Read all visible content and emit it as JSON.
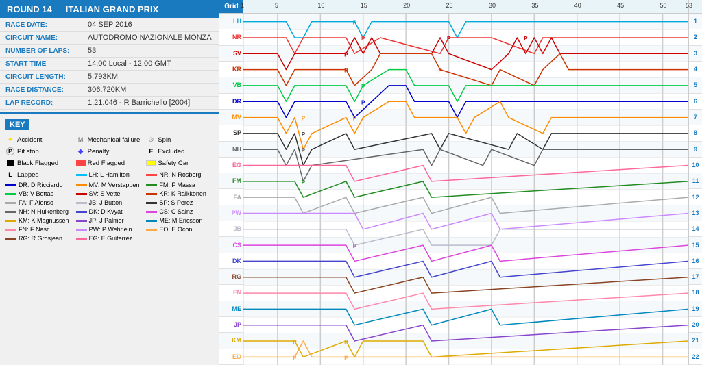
{
  "header": {
    "round": "ROUND 14",
    "race_name": "ITALIAN GRAND PRIX"
  },
  "race_info": [
    {
      "label": "RACE DATE:",
      "value": "04 SEP 2016"
    },
    {
      "label": "CIRCUIT NAME:",
      "value": "AUTODROMO NAZIONALE MONZA"
    },
    {
      "label": "NUMBER OF LAPS:",
      "value": "53"
    },
    {
      "label": "START TIME",
      "value": "14:00 Local - 12:00 GMT"
    },
    {
      "label": "CIRCUIT LENGTH:",
      "value": "5.793KM"
    },
    {
      "label": "RACE DISTANCE:",
      "value": "306.720KM"
    },
    {
      "label": "LAP RECORD:",
      "value": "1:21.046 - R Barrichello [2004]"
    }
  ],
  "key_title": "KEY",
  "key_legend": [
    {
      "icon": "star",
      "label": "Accident"
    },
    {
      "icon": "M",
      "label": "Mechanical failure"
    },
    {
      "icon": "circle-s",
      "label": "Spin"
    },
    {
      "icon": "P-circle",
      "label": "Pit stop"
    },
    {
      "icon": "diamond",
      "label": "Penalty"
    },
    {
      "icon": "E",
      "label": "Excluded"
    },
    {
      "icon": "black-square",
      "label": "Black Flagged"
    },
    {
      "icon": "red-rect",
      "label": "Red Flagged"
    },
    {
      "icon": "yellow-rect",
      "label": "Safety Car"
    },
    {
      "icon": "L",
      "label": "Lapped"
    },
    {
      "icon": "line-lh",
      "label": "LH: L Hamilton",
      "color": "#00bfff"
    },
    {
      "icon": "line-nr",
      "label": "NR: N Rosberg",
      "color": "#ff4444"
    },
    {
      "icon": "line-dr",
      "label": "DR: D Ricciardo",
      "color": "#0000cd"
    },
    {
      "icon": "line-mv",
      "label": "MV: M Verstappen",
      "color": "#ff8c00"
    },
    {
      "icon": "line-fm",
      "label": "FM: F Massa",
      "color": "#228b22"
    },
    {
      "icon": "line-vb",
      "label": "VB: V Bottas",
      "color": "#00cc44"
    },
    {
      "icon": "line-sv",
      "label": "SV: S Vettel",
      "color": "#cc0000"
    },
    {
      "icon": "line-kr",
      "label": "KR: K Raikkonen",
      "color": "#cc3300"
    },
    {
      "icon": "line-fa",
      "label": "FA: F Alonso",
      "color": "#aaaaaa"
    },
    {
      "icon": "line-jb",
      "label": "JB: J Button",
      "color": "#bbbbcc"
    },
    {
      "icon": "line-sp",
      "label": "SP: S Perez",
      "color": "#333333"
    },
    {
      "icon": "line-nh",
      "label": "NH: N Hulkenberg",
      "color": "#666666"
    },
    {
      "icon": "line-dk",
      "label": "DK: D Kvyat",
      "color": "#4444cc"
    },
    {
      "icon": "line-cs",
      "label": "CS: C Sainz",
      "color": "#dd44dd"
    },
    {
      "icon": "line-km",
      "label": "KM: K Magnussen",
      "color": "#ddaa00"
    },
    {
      "icon": "line-jp",
      "label": "JP: J Palmer",
      "color": "#8844cc"
    },
    {
      "icon": "line-me",
      "label": "ME: M Ericsson",
      "color": "#0088bb"
    },
    {
      "icon": "line-fn",
      "label": "FN: F Nasr",
      "color": "#ff88aa"
    },
    {
      "icon": "line-pw",
      "label": "PW: P Wehrlein",
      "color": "#cc88ff"
    },
    {
      "icon": "line-eo",
      "label": "EO: E Ocon",
      "color": "#ffaa44"
    },
    {
      "icon": "line-rg",
      "label": "RG: R Grosjean",
      "color": "#884422"
    },
    {
      "icon": "line-eg",
      "label": "EG: E Guiterrez",
      "color": "#ff6699"
    }
  ],
  "chart": {
    "grid_label": "Grid",
    "total_laps": 53,
    "lap_markers": [
      1,
      5,
      10,
      15,
      20,
      25,
      30,
      35,
      40,
      45,
      50,
      53
    ],
    "rows": [
      {
        "pos": "1",
        "driver": "LH",
        "color": "#00aadd"
      },
      {
        "pos": "2",
        "driver": "NR",
        "color": "#ee3333"
      },
      {
        "pos": "3",
        "driver": "SV",
        "color": "#cc0000"
      },
      {
        "pos": "4",
        "driver": "KR",
        "color": "#cc3300"
      },
      {
        "pos": "5",
        "driver": "VB",
        "color": "#00cc44"
      },
      {
        "pos": "6",
        "driver": "DR",
        "color": "#0000cd"
      },
      {
        "pos": "7",
        "driver": "MV",
        "color": "#ff8c00"
      },
      {
        "pos": "8",
        "driver": "SP",
        "color": "#333333"
      },
      {
        "pos": "9",
        "driver": "NH",
        "color": "#666666"
      },
      {
        "pos": "10",
        "driver": "EG",
        "color": "#ff6699"
      },
      {
        "pos": "11",
        "driver": "FM",
        "color": "#228b22"
      },
      {
        "pos": "12",
        "driver": "FA",
        "color": "#aaaaaa"
      },
      {
        "pos": "13",
        "driver": "PW",
        "color": "#cc88ff"
      },
      {
        "pos": "14",
        "driver": "JB",
        "color": "#bbbbcc"
      },
      {
        "pos": "15",
        "driver": "CS",
        "color": "#dd44dd"
      },
      {
        "pos": "16",
        "driver": "DK",
        "color": "#4444cc"
      },
      {
        "pos": "17",
        "driver": "RG",
        "color": "#884422"
      },
      {
        "pos": "18",
        "driver": "FN",
        "color": "#ff88aa"
      },
      {
        "pos": "19",
        "driver": "ME",
        "color": "#0088bb"
      },
      {
        "pos": "20",
        "driver": "JP",
        "color": "#8844cc"
      },
      {
        "pos": "21",
        "driver": "KM",
        "color": "#ddaa00"
      },
      {
        "pos": "22",
        "driver": "EO",
        "color": "#ffaa44"
      }
    ]
  }
}
